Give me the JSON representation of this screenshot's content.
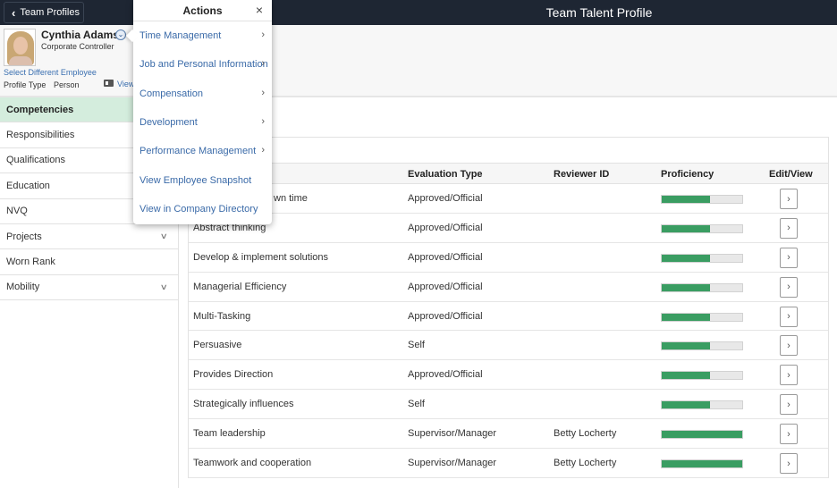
{
  "topbar": {
    "back_label": "Team Profiles",
    "title": "Team Talent Profile"
  },
  "profile": {
    "name": "Cynthia Adams",
    "job_title": "Corporate Controller",
    "select_link": "Select Different Employee",
    "profile_type_label": "Profile Type",
    "profile_type_value": "Person",
    "view_link": "View"
  },
  "sidebar": {
    "items": [
      {
        "label": "Competencies",
        "active": true,
        "expandable": false
      },
      {
        "label": "Responsibilities",
        "active": false,
        "expandable": false
      },
      {
        "label": "Qualifications",
        "active": false,
        "expandable": false
      },
      {
        "label": "Education",
        "active": false,
        "expandable": false
      },
      {
        "label": "NVQ",
        "active": false,
        "expandable": false
      },
      {
        "label": "Projects",
        "active": false,
        "expandable": true
      },
      {
        "label": "Worn Rank",
        "active": false,
        "expandable": false
      },
      {
        "label": "Mobility",
        "active": false,
        "expandable": true
      }
    ]
  },
  "actions_menu": {
    "title": "Actions",
    "close_icon": "close-icon",
    "items": [
      {
        "label": "Time Management",
        "submenu": true
      },
      {
        "label": "Job and Personal Information",
        "submenu": true
      },
      {
        "label": "Compensation",
        "submenu": true
      },
      {
        "label": "Development",
        "submenu": true
      },
      {
        "label": "Performance Management",
        "submenu": true
      },
      {
        "label": "View Employee Snapshot",
        "submenu": false
      },
      {
        "label": "View in Company Directory",
        "submenu": false
      }
    ]
  },
  "table": {
    "columns": [
      "Evaluation Type",
      "Reviewer ID",
      "Proficiency",
      "Edit/View"
    ],
    "rows": [
      {
        "competency": "wn time",
        "evaluation_type": "Approved/Official",
        "reviewer": "",
        "proficiency": 0.6
      },
      {
        "competency": "Abstract thinking",
        "evaluation_type": "Approved/Official",
        "reviewer": "",
        "proficiency": 0.6
      },
      {
        "competency": "Develop & implement solutions",
        "evaluation_type": "Approved/Official",
        "reviewer": "",
        "proficiency": 0.6
      },
      {
        "competency": "Managerial Efficiency",
        "evaluation_type": "Approved/Official",
        "reviewer": "",
        "proficiency": 0.6
      },
      {
        "competency": "Multi-Tasking",
        "evaluation_type": "Approved/Official",
        "reviewer": "",
        "proficiency": 0.6
      },
      {
        "competency": "Persuasive",
        "evaluation_type": "Self",
        "reviewer": "",
        "proficiency": 0.6
      },
      {
        "competency": "Provides Direction",
        "evaluation_type": "Approved/Official",
        "reviewer": "",
        "proficiency": 0.6
      },
      {
        "competency": "Strategically influences",
        "evaluation_type": "Self",
        "reviewer": "",
        "proficiency": 0.6
      },
      {
        "competency": "Team leadership",
        "evaluation_type": "Supervisor/Manager",
        "reviewer": "Betty Locherty",
        "proficiency": 1.0
      },
      {
        "competency": "Teamwork and cooperation",
        "evaluation_type": "Supervisor/Manager",
        "reviewer": "Betty Locherty",
        "proficiency": 1.0
      }
    ],
    "edit_label": "›"
  },
  "colors": {
    "topbar": "#1e2633",
    "active_sidebar": "#d4eddd",
    "proficiency_fill": "#3a9d62",
    "link": "#3a6aa8"
  }
}
